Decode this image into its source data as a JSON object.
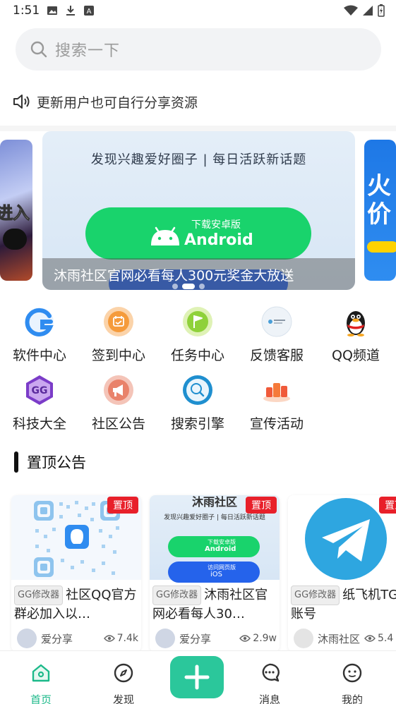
{
  "status_bar": {
    "time": "1:51"
  },
  "search": {
    "placeholder": "搜索一下"
  },
  "notice": {
    "text": "更新用户也可自行分享资源"
  },
  "banner": {
    "headline": "发现兴趣爱好圈子 | 每日活跃新话题",
    "android_small": "下载安卓版",
    "android_big": "Android",
    "caption": "沐雨社区官网必看每人300元奖金大放送",
    "left_peek": "进入",
    "right_peek": "火价"
  },
  "grid": [
    {
      "label": "软件中心",
      "icon": "software-center-icon",
      "color": "#2f8cf0"
    },
    {
      "label": "签到中心",
      "icon": "checkin-icon",
      "color": "#f59b3c"
    },
    {
      "label": "任务中心",
      "icon": "task-flag-icon",
      "color": "#8fd13a"
    },
    {
      "label": "反馈客服",
      "icon": "feedback-logo-icon",
      "color": "#e6eef6"
    },
    {
      "label": "QQ频道",
      "icon": "qq-penguin-icon",
      "color": "#222222"
    },
    {
      "label": "科技大全",
      "icon": "gg-tech-icon",
      "color": "#7b3cc8"
    },
    {
      "label": "社区公告",
      "icon": "announcement-icon",
      "color": "#e9826a"
    },
    {
      "label": "搜索引擎",
      "icon": "search-engine-icon",
      "color": "#1f8fcf"
    },
    {
      "label": "宣传活动",
      "icon": "promotion-icon",
      "color": "#f05a3a"
    }
  ],
  "section": {
    "title": "置顶公告"
  },
  "cards": [
    {
      "pin": "置顶",
      "tag": "GG修改器",
      "title": "社区QQ官方群必加入以…",
      "author": "爱分享",
      "views": "7.4k"
    },
    {
      "pin": "置顶",
      "tag": "GG修改器",
      "title": "沐雨社区官网必看每人30…",
      "author": "爱分享",
      "views": "2.9w"
    },
    {
      "pin": "置顶",
      "tag": "GG修改器",
      "title": "纸飞机TG账号",
      "author": "沐雨社区",
      "views": "5.4"
    }
  ],
  "card2_thumb": {
    "heading": "沐雨社区",
    "sub": "发现兴趣爱好圈子 | 每日活跃新话题",
    "android_small": "下载安卓版",
    "android_big": "Android",
    "ios_small": "访问网页版",
    "ios_big": "iOS"
  },
  "nav": [
    {
      "label": "首页",
      "icon": "home-icon"
    },
    {
      "label": "发现",
      "icon": "compass-icon"
    },
    {
      "label": "消息",
      "icon": "message-icon"
    },
    {
      "label": "我的",
      "icon": "profile-icon"
    }
  ]
}
